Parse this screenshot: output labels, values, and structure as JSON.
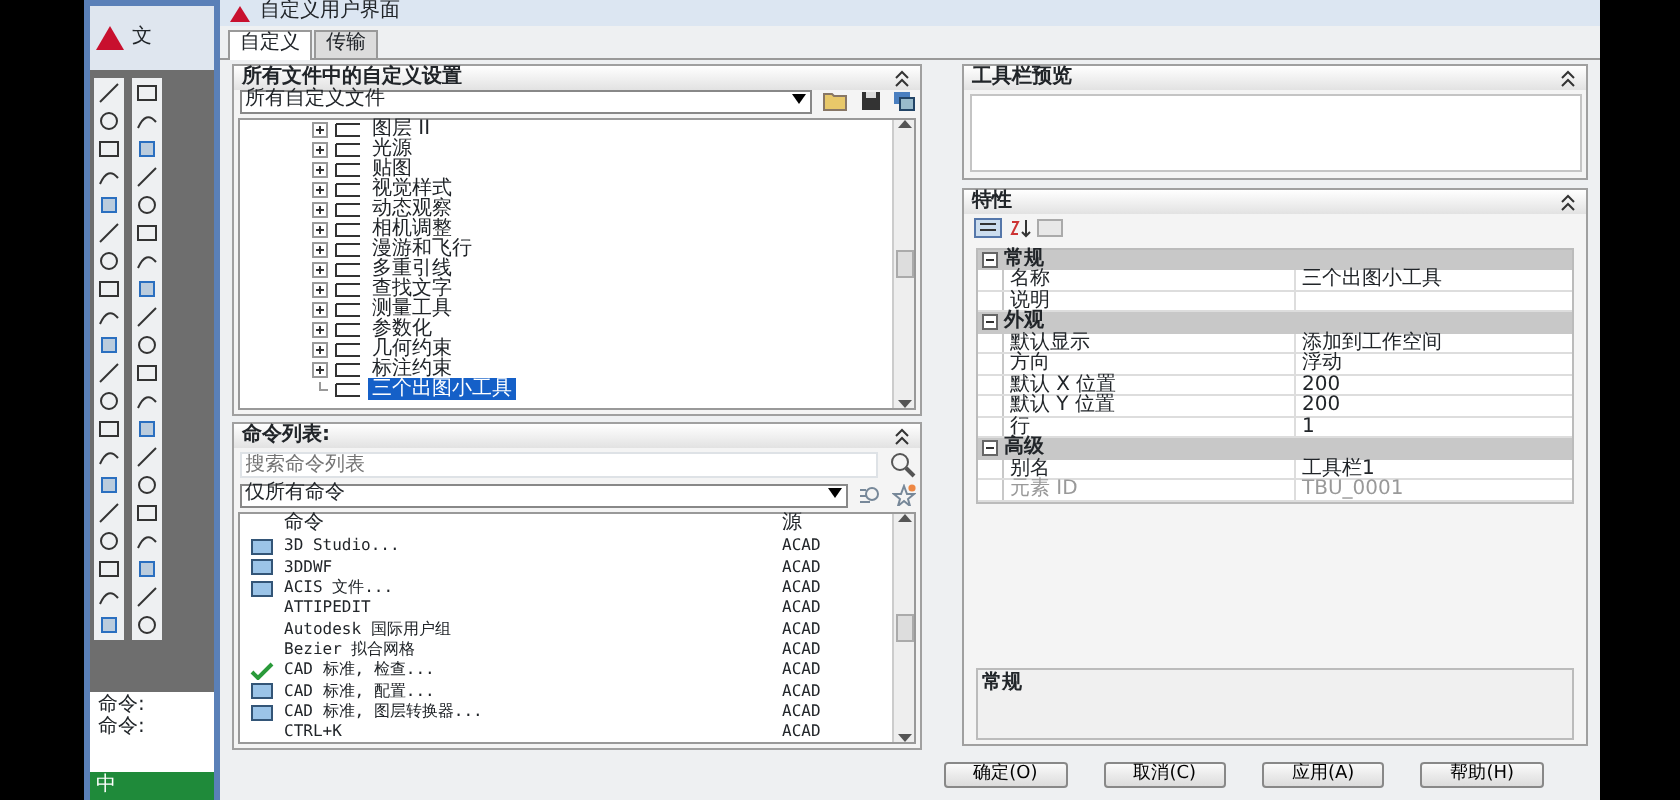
{
  "app": {
    "menu_partial": "文",
    "command_lines": [
      "命令:",
      "命令:"
    ],
    "ime": "中"
  },
  "window": {
    "title": "自定义用户界面"
  },
  "tabs": [
    {
      "label": "自定义",
      "selected": true
    },
    {
      "label": "传输",
      "selected": false
    }
  ],
  "customizations": {
    "title": "所有文件中的自定义设置",
    "dropdown": "所有自定义文件",
    "tree": [
      {
        "label": "图层 II",
        "expandable": true,
        "selected": false
      },
      {
        "label": "光源",
        "expandable": true,
        "selected": false
      },
      {
        "label": "贴图",
        "expandable": true,
        "selected": false
      },
      {
        "label": "视觉样式",
        "expandable": true,
        "selected": false
      },
      {
        "label": "动态观察",
        "expandable": true,
        "selected": false
      },
      {
        "label": "相机调整",
        "expandable": true,
        "selected": false
      },
      {
        "label": "漫游和飞行",
        "expandable": true,
        "selected": false
      },
      {
        "label": "多重引线",
        "expandable": true,
        "selected": false
      },
      {
        "label": "查找文字",
        "expandable": true,
        "selected": false
      },
      {
        "label": "测量工具",
        "expandable": true,
        "selected": false
      },
      {
        "label": "参数化",
        "expandable": true,
        "selected": false
      },
      {
        "label": "几何约束",
        "expandable": true,
        "selected": false
      },
      {
        "label": "标注约束",
        "expandable": true,
        "selected": false
      },
      {
        "label": "三个出图小工具",
        "expandable": false,
        "selected": true
      }
    ]
  },
  "command_list": {
    "title": "命令列表:",
    "search": {
      "placeholder": "搜索命令列表"
    },
    "filter": "仅所有命令",
    "columns": [
      "命令",
      "源"
    ],
    "rows": [
      {
        "kind": "image",
        "name": "3D Studio...",
        "source": "ACAD"
      },
      {
        "kind": "image",
        "name": "3DDWF",
        "source": "ACAD"
      },
      {
        "kind": "image",
        "name": "ACIS 文件...",
        "source": "ACAD"
      },
      {
        "kind": "plain",
        "name": "ATTIPEDIT",
        "source": "ACAD"
      },
      {
        "kind": "plain",
        "name": "Autodesk 国际用户组",
        "source": "ACAD"
      },
      {
        "kind": "plain",
        "name": "Bezier 拟合网格",
        "source": "ACAD"
      },
      {
        "kind": "check",
        "name": "CAD 标准, 检查...",
        "source": "ACAD"
      },
      {
        "kind": "image",
        "name": "CAD 标准, 配置...",
        "source": "ACAD"
      },
      {
        "kind": "image",
        "name": "CAD 标准, 图层转换器...",
        "source": "ACAD"
      },
      {
        "kind": "plain",
        "name": "CTRL+K",
        "source": "ACAD"
      }
    ]
  },
  "toolbar_preview": {
    "title": "工具栏预览"
  },
  "properties": {
    "title": "特性",
    "groups": [
      {
        "name": "常规",
        "rows": [
          {
            "name": "名称",
            "value": "三个出图小工具",
            "disabled": false
          },
          {
            "name": "说明",
            "value": "",
            "disabled": false
          }
        ]
      },
      {
        "name": "外观",
        "rows": [
          {
            "name": "默认显示",
            "value": "添加到工作空间",
            "disabled": false
          },
          {
            "name": "方向",
            "value": "浮动",
            "disabled": false
          },
          {
            "name": "默认 X 位置",
            "value": "200",
            "disabled": false
          },
          {
            "name": "默认 Y 位置",
            "value": "200",
            "disabled": false
          },
          {
            "name": "行",
            "value": "1",
            "disabled": false
          }
        ]
      },
      {
        "name": "高级",
        "rows": [
          {
            "name": "别名",
            "value": "工具栏1",
            "disabled": false
          },
          {
            "name": "元素 ID",
            "value": "TBU_0001",
            "disabled": true
          }
        ]
      }
    ],
    "description": "常规"
  },
  "buttons": [
    "确定(O)",
    "取消(C)",
    "应用(A)",
    "帮助(H)"
  ]
}
